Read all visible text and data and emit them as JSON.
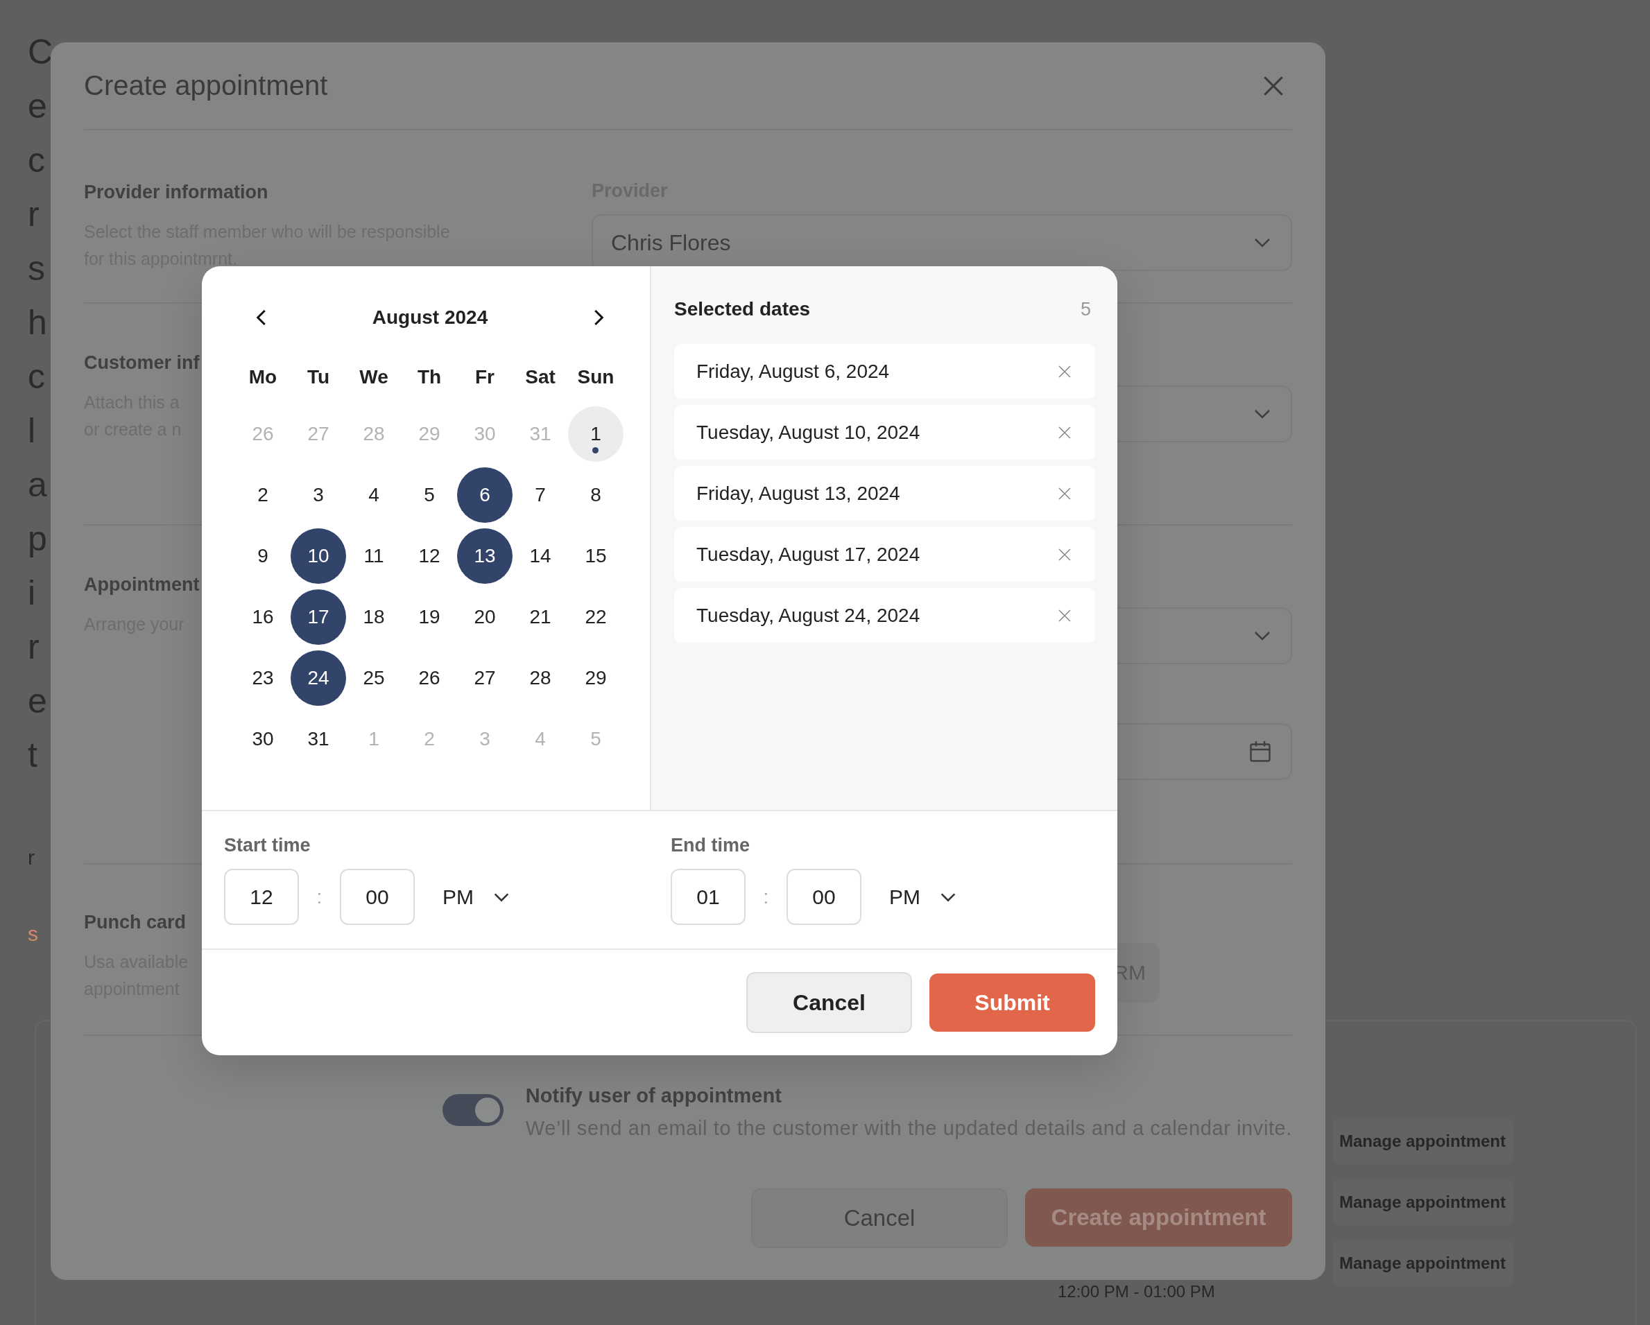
{
  "background": {
    "side_letters": [
      {
        "text": "C",
        "kind": "large"
      },
      {
        "text": "e",
        "kind": "large"
      },
      {
        "text": "c",
        "kind": "large"
      },
      {
        "text": "r",
        "kind": "large"
      },
      {
        "text": "s",
        "kind": "large"
      },
      {
        "text": "h",
        "kind": "large"
      },
      {
        "text": "c",
        "kind": "large"
      },
      {
        "text": "l",
        "kind": "large"
      },
      {
        "text": "a",
        "kind": "large"
      },
      {
        "text": "p",
        "kind": "large"
      },
      {
        "text": "i",
        "kind": "large"
      },
      {
        "text": "r",
        "kind": "large"
      },
      {
        "text": "e",
        "kind": "large"
      },
      {
        "text": "t",
        "kind": "large"
      },
      {
        "text": "r",
        "kind": "small"
      },
      {
        "text": "s",
        "kind": "link"
      }
    ],
    "manage_links": [
      "Manage appointment",
      "Manage appointment",
      "Manage appointment"
    ],
    "time_range": "12:00 PM - 01:00 PM"
  },
  "modal": {
    "title": "Create appointment",
    "sections": [
      {
        "heading": "Provider information",
        "description": [
          "Select the staff member who will be responsible",
          "for this appointmrnt."
        ],
        "fields": [
          {
            "kind": "select",
            "label": "Provider",
            "value": "Chris Flores"
          }
        ]
      },
      {
        "heading": "Customer inf",
        "description": [
          "Attach this a",
          "or create a n"
        ],
        "fields": [
          {
            "kind": "select"
          }
        ]
      },
      {
        "heading": "Appointment",
        "description": [
          "Arrange your"
        ],
        "fields": [
          {
            "kind": "select"
          },
          {
            "kind": "date"
          }
        ]
      },
      {
        "heading": "Punch card",
        "description": [
          "Usa available",
          "appointment"
        ],
        "fields": [
          {
            "kind": "button",
            "value": "RM"
          }
        ]
      }
    ],
    "notify": {
      "on": true,
      "title": "Notify user of appointment",
      "description": "We’ll send an email to the customer with the updated details and a calendar invite."
    },
    "cancel": "Cancel",
    "create": "Create appointment"
  },
  "date_picker": {
    "month": "August 2024",
    "weekdays": [
      "Mo",
      "Tu",
      "We",
      "Th",
      "Fr",
      "Sat",
      "Sun"
    ],
    "days": [
      {
        "label": "26",
        "kind": "outside",
        "selected": false,
        "today": false
      },
      {
        "label": "27",
        "kind": "outside",
        "selected": false,
        "today": false
      },
      {
        "label": "28",
        "kind": "outside",
        "selected": false,
        "today": false
      },
      {
        "label": "29",
        "kind": "outside",
        "selected": false,
        "today": false
      },
      {
        "label": "30",
        "kind": "outside",
        "selected": false,
        "today": false
      },
      {
        "label": "31",
        "kind": "outside",
        "selected": false,
        "today": false
      },
      {
        "label": "1",
        "kind": "current",
        "selected": false,
        "today": true
      },
      {
        "label": "2",
        "kind": "current",
        "selected": false,
        "today": false
      },
      {
        "label": "3",
        "kind": "current",
        "selected": false,
        "today": false
      },
      {
        "label": "4",
        "kind": "current",
        "selected": false,
        "today": false
      },
      {
        "label": "5",
        "kind": "current",
        "selected": false,
        "today": false
      },
      {
        "label": "6",
        "kind": "current",
        "selected": true,
        "today": false
      },
      {
        "label": "7",
        "kind": "current",
        "selected": false,
        "today": false
      },
      {
        "label": "8",
        "kind": "current",
        "selected": false,
        "today": false
      },
      {
        "label": "9",
        "kind": "current",
        "selected": false,
        "today": false
      },
      {
        "label": "10",
        "kind": "current",
        "selected": true,
        "today": false
      },
      {
        "label": "11",
        "kind": "current",
        "selected": false,
        "today": false
      },
      {
        "label": "12",
        "kind": "current",
        "selected": false,
        "today": false
      },
      {
        "label": "13",
        "kind": "current",
        "selected": true,
        "today": false
      },
      {
        "label": "14",
        "kind": "current",
        "selected": false,
        "today": false
      },
      {
        "label": "15",
        "kind": "current",
        "selected": false,
        "today": false
      },
      {
        "label": "16",
        "kind": "current",
        "selected": false,
        "today": false
      },
      {
        "label": "17",
        "kind": "current",
        "selected": true,
        "today": false
      },
      {
        "label": "18",
        "kind": "current",
        "selected": false,
        "today": false
      },
      {
        "label": "19",
        "kind": "current",
        "selected": false,
        "today": false
      },
      {
        "label": "20",
        "kind": "current",
        "selected": false,
        "today": false
      },
      {
        "label": "21",
        "kind": "current",
        "selected": false,
        "today": false
      },
      {
        "label": "22",
        "kind": "current",
        "selected": false,
        "today": false
      },
      {
        "label": "23",
        "kind": "current",
        "selected": false,
        "today": false
      },
      {
        "label": "24",
        "kind": "current",
        "selected": true,
        "today": false
      },
      {
        "label": "25",
        "kind": "current",
        "selected": false,
        "today": false
      },
      {
        "label": "26",
        "kind": "current",
        "selected": false,
        "today": false
      },
      {
        "label": "27",
        "kind": "current",
        "selected": false,
        "today": false
      },
      {
        "label": "28",
        "kind": "current",
        "selected": false,
        "today": false
      },
      {
        "label": "29",
        "kind": "current",
        "selected": false,
        "today": false
      },
      {
        "label": "30",
        "kind": "current",
        "selected": false,
        "today": false
      },
      {
        "label": "31",
        "kind": "current",
        "selected": false,
        "today": false
      },
      {
        "label": "1",
        "kind": "outside",
        "selected": false,
        "today": false
      },
      {
        "label": "2",
        "kind": "outside",
        "selected": false,
        "today": false
      },
      {
        "label": "3",
        "kind": "outside",
        "selected": false,
        "today": false
      },
      {
        "label": "4",
        "kind": "outside",
        "selected": false,
        "today": false
      },
      {
        "label": "5",
        "kind": "outside",
        "selected": false,
        "today": false
      }
    ],
    "selected_title": "Selected dates",
    "selected_count": "5",
    "selected_dates": [
      "Friday, August 6, 2024",
      "Tuesday, August 10, 2024",
      "Friday, August 13, 2024",
      "Tuesday, August 17, 2024",
      "Tuesday, August 24, 2024"
    ],
    "times": [
      {
        "label": "Start time",
        "hour": "12",
        "separator": ":",
        "minute": "00",
        "period": "PM"
      },
      {
        "label": "End time",
        "hour": "01",
        "separator": ":",
        "minute": "00",
        "period": "PM"
      }
    ],
    "cancel": "Cancel",
    "submit": "Submit"
  }
}
